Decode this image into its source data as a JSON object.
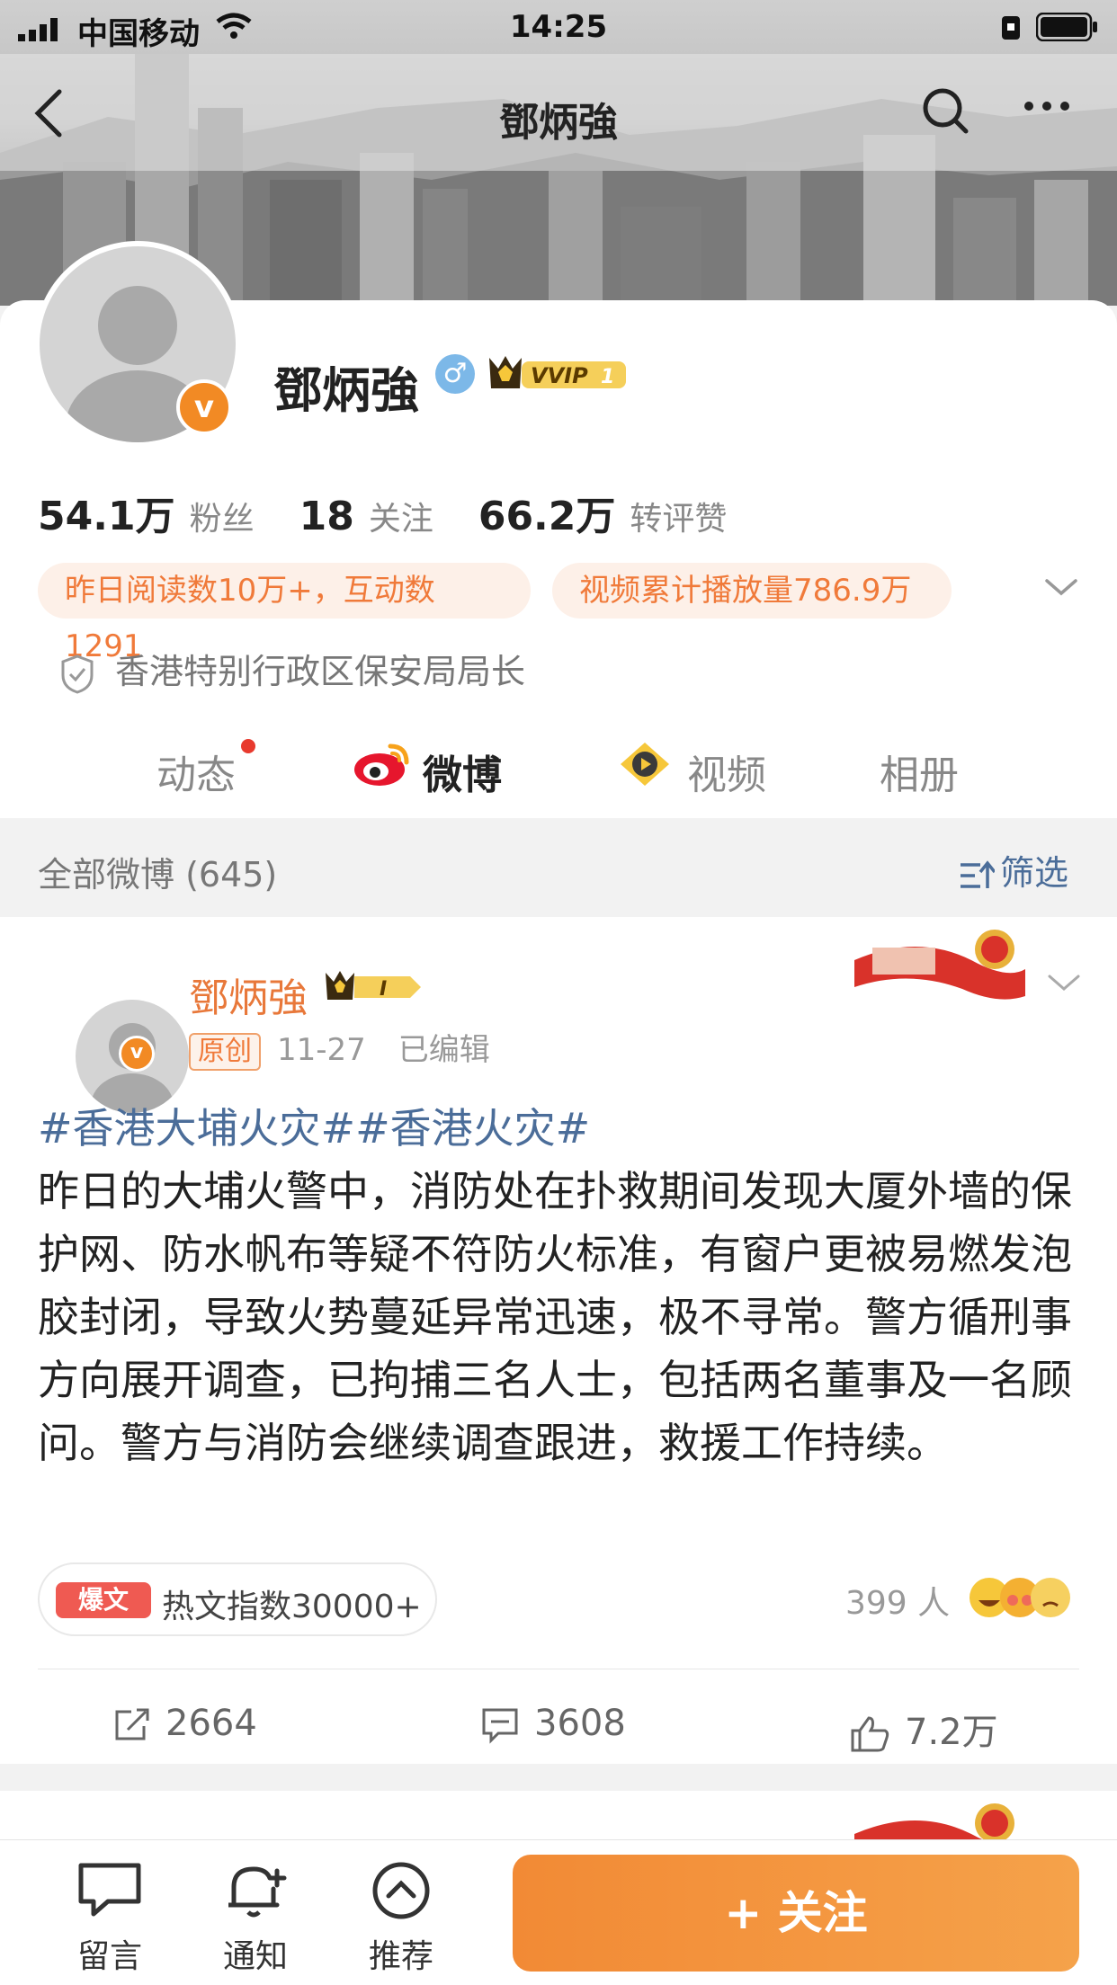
{
  "status_bar": {
    "carrier": "中国移动",
    "time": "14:25"
  },
  "nav": {
    "title": "鄧炳強"
  },
  "profile": {
    "name": "鄧炳強",
    "gender_symbol": "♂",
    "vip_label": "VVIP",
    "vip_level": "1",
    "badge_letter": "v",
    "stats": [
      {
        "num": "54.1万",
        "label": "粉丝"
      },
      {
        "num": "18",
        "label": "关注"
      },
      {
        "num": "66.2万",
        "label": "转评赞"
      }
    ],
    "pills": [
      "昨日阅读数10万+，互动数1291",
      "视频累计播放量786.9万"
    ],
    "verification": "香港特别行政区保安局局长"
  },
  "tabs": [
    {
      "label": "动态",
      "has_dot": true
    },
    {
      "label": "微博",
      "active": true
    },
    {
      "label": "视频"
    },
    {
      "label": "相册"
    }
  ],
  "filter_bar": {
    "all_label": "全部微博 (645)",
    "filter_label": "筛选"
  },
  "post": {
    "author": "鄧炳強",
    "vip_level": "I",
    "original_tag": "原创",
    "date": "11-27",
    "edited": "已编辑",
    "topics": "#香港大埔火灾##香港火灾#",
    "text": "昨日的大埔火警中，消防处在扑救期间发现大厦外墙的保护网、防水帆布等疑不符防火标准，有窗户更被易燃发泡胶封闭，导致火势蔓延异常迅速，极不寻常。警方循刑事方向展开调查，已拘捕三名人士，包括两名董事及一名顾问。警方与消防会继续调查跟进，救援工作持续。",
    "hot_tag": "爆文",
    "hot_text": "热文指数30000+",
    "reactions": "399 人",
    "reposts": "2664",
    "comments": "3608",
    "likes": "7.2万"
  },
  "bottom_bar": {
    "message": "留言",
    "notify": "通知",
    "recommend": "推荐",
    "follow": "+ 关注"
  },
  "colors": {
    "accent": "#f47c2a",
    "link": "#4b6d99",
    "hot": "#ef5a52"
  }
}
